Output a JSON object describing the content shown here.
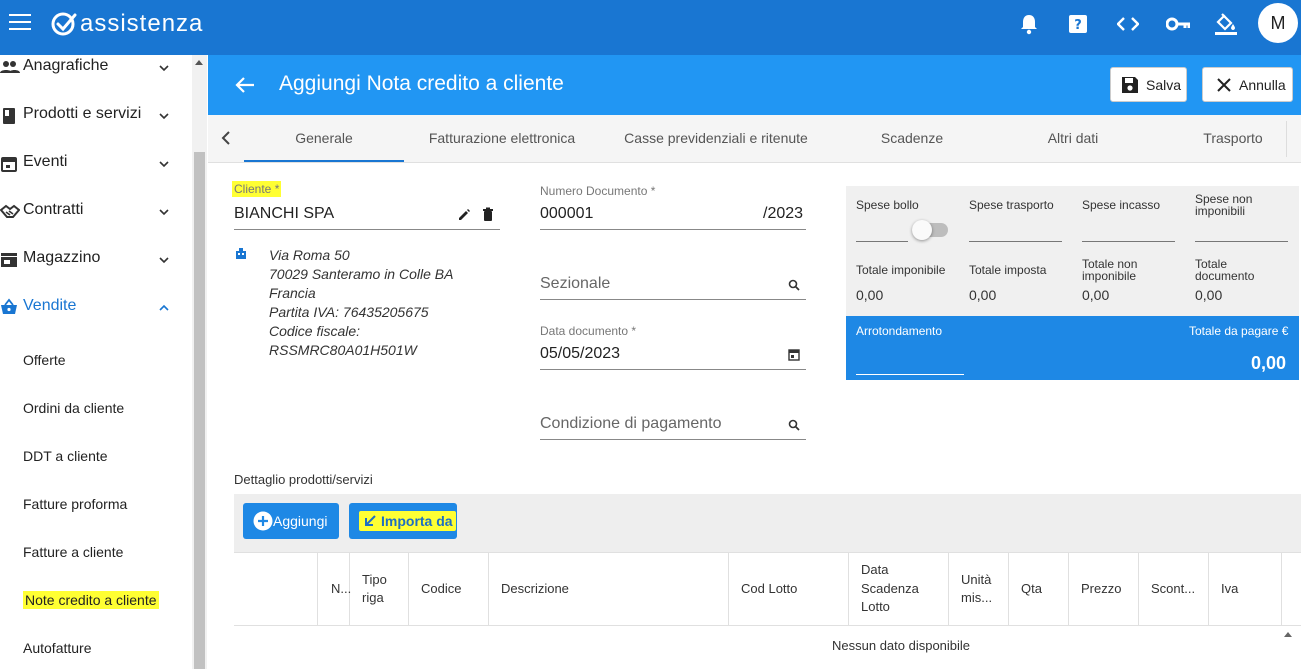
{
  "app": {
    "logo_text": "assistenza",
    "avatar_initial": "M"
  },
  "topbar_icons": [
    "bell-icon",
    "help-icon",
    "code-icon",
    "key-icon",
    "paint-bucket-icon"
  ],
  "sidebar": {
    "groups": [
      {
        "label": "Anagrafiche",
        "icon": "people-icon"
      },
      {
        "label": "Prodotti e servizi",
        "icon": "book-icon"
      },
      {
        "label": "Eventi",
        "icon": "calendar-icon"
      },
      {
        "label": "Contratti",
        "icon": "handshake-icon"
      },
      {
        "label": "Magazzino",
        "icon": "store-icon"
      },
      {
        "label": "Vendite",
        "icon": "basket-icon"
      }
    ],
    "vendite_items": [
      "Offerte",
      "Ordini da cliente",
      "DDT a cliente",
      "Fatture proforma",
      "Fatture a cliente",
      "Note credito a cliente",
      "Autofatture"
    ]
  },
  "header": {
    "title": "Aggiungi Nota credito a cliente",
    "save_label": "Salva",
    "cancel_label": "Annulla"
  },
  "tabs": [
    "Generale",
    "Fatturazione elettronica",
    "Casse previdenziali e ritenute",
    "Scadenze",
    "Altri dati",
    "Trasporto"
  ],
  "form": {
    "cliente_label": "Cliente *",
    "cliente_value": "BIANCHI SPA",
    "address": {
      "line1": "Via Roma 50",
      "line2": "70029 Santeramo in Colle BA",
      "line3": "Francia",
      "line4": "Partita IVA: 76435205675",
      "line5": "Codice fiscale:",
      "line6": "RSSMRC80A01H501W"
    },
    "numero_label": "Numero Documento *",
    "numero_value": "000001",
    "numero_suffix": "/2023",
    "sezionale_placeholder": "Sezionale",
    "data_label": "Data documento *",
    "data_value": "05/05/2023",
    "condizione_placeholder": "Condizione di pagamento"
  },
  "totals": {
    "spese_bollo": "Spese bollo",
    "spese_trasporto": "Spese trasporto",
    "spese_incasso": "Spese incasso",
    "spese_non_imponibili_1": "Spese non",
    "spese_non_imponibili_2": "imponibili",
    "totale_imponibile": "Totale imponibile",
    "totale_imposta": "Totale imposta",
    "totale_non_imponibile_1": "Totale non",
    "totale_non_imponibile_2": "imponibile",
    "totale_documento_1": "Totale",
    "totale_documento_2": "documento",
    "val_imponibile": "0,00",
    "val_imposta": "0,00",
    "val_non_imponibile": "0,00",
    "val_documento": "0,00",
    "arrotondamento": "Arrotondamento",
    "totale_pagare_label": "Totale da pagare €",
    "totale_pagare_value": "0,00"
  },
  "detail": {
    "section_label": "Dettaglio prodotti/servizi",
    "add_label": "Aggiungi",
    "import_label": "Importa da",
    "columns": {
      "n": "N...",
      "tipo_1": "Tipo",
      "tipo_2": "riga",
      "codice": "Codice",
      "descrizione": "Descrizione",
      "cod_lotto": "Cod Lotto",
      "data_1": "Data",
      "data_2": "Scadenza",
      "data_3": "Lotto",
      "unita_1": "Unità",
      "unita_2": "mis...",
      "qta": "Qta",
      "prezzo": "Prezzo",
      "sconto": "Scont...",
      "iva": "Iva"
    },
    "empty_text": "Nessun dato disponibile"
  },
  "colors": {
    "primary": "#1976d2",
    "header_blue": "#2196f3",
    "highlight": "#ffff33"
  }
}
